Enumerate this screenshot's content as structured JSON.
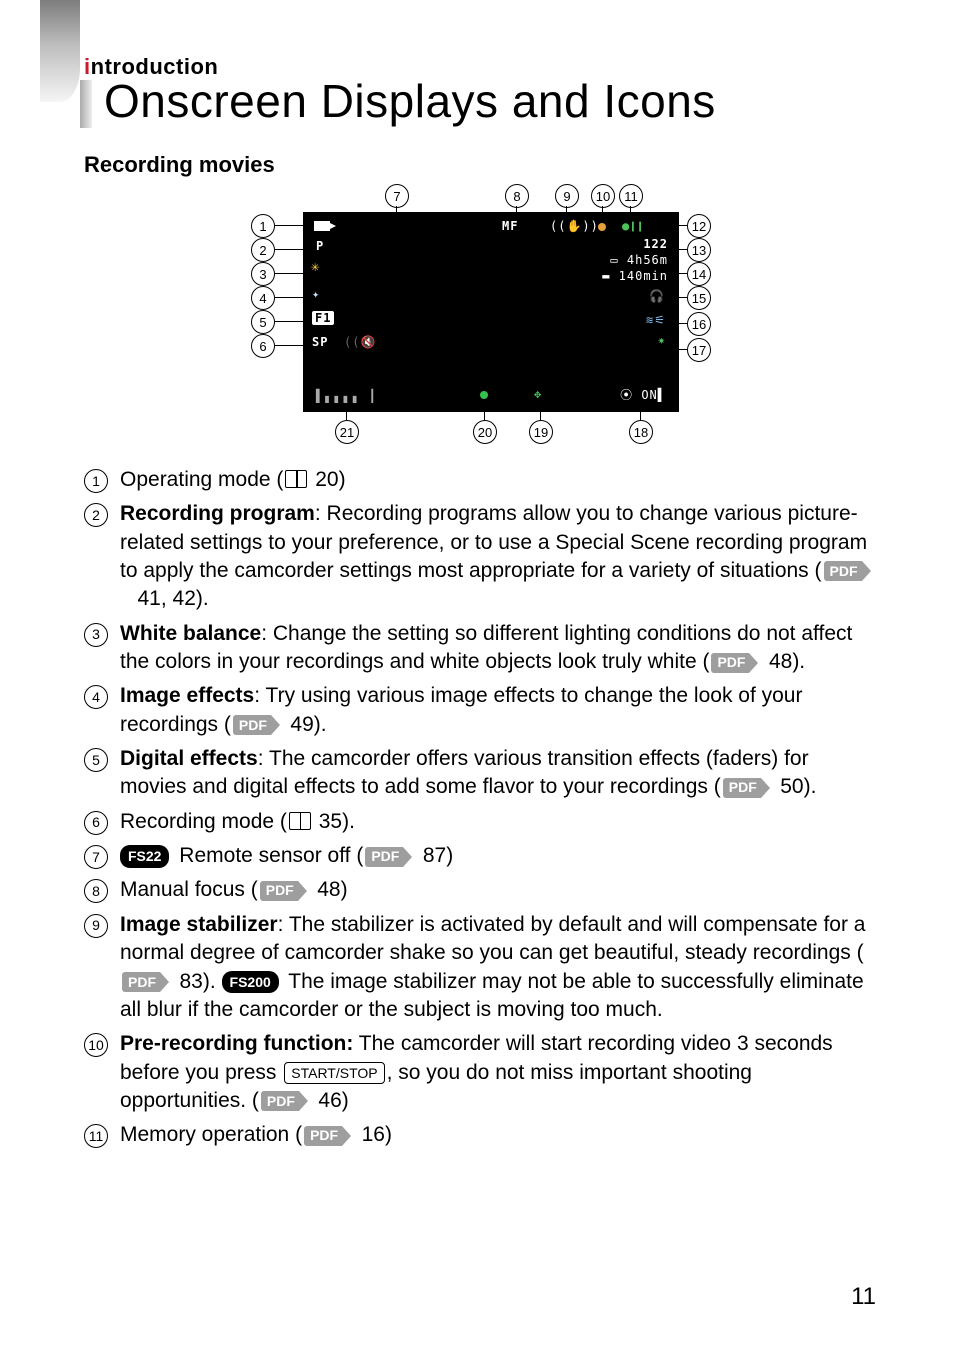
{
  "header": {
    "kicker_i": "i",
    "kicker_rest": "ntroduction",
    "title": "Onscreen Displays and Icons"
  },
  "section_heading": "Recording movies",
  "pdf_label": "PDF",
  "key_label": "START/STOP",
  "models": {
    "fs22": "FS22",
    "fs200": "FS200"
  },
  "diagram": {
    "top_numbers": [
      "7",
      "8",
      "9",
      "10",
      "11"
    ],
    "left_numbers": [
      "1",
      "2",
      "3",
      "4",
      "5",
      "6"
    ],
    "right_numbers": [
      "12",
      "13",
      "14",
      "15",
      "16",
      "17"
    ],
    "bottom_numbers": [
      "21",
      "20",
      "19",
      "18"
    ],
    "lcd": {
      "mf": "MF",
      "count": "122",
      "time": "4h56m",
      "battery": "140min",
      "sp": "SP",
      "p": "P",
      "f1": "F1",
      "on": "ON",
      "pause": "●❙❙"
    }
  },
  "notes": [
    {
      "n": "1",
      "lead": "",
      "title": "",
      "text_a": "Operating mode (",
      "book": true,
      "text_b": " 20)"
    },
    {
      "n": "2",
      "title": "Recording program",
      "text_a": ": Recording programs allow you to change various picture-related settings to your preference, or to use a Special Scene recording program to apply the camcorder settings most appropriate for a variety of situations (",
      "pdf": true,
      "text_b": " 41, 42)."
    },
    {
      "n": "3",
      "title": "White balance",
      "text_a": ": Change the setting so different lighting conditions do not affect the colors in your recordings and white objects look truly white (",
      "pdf": true,
      "text_b": " 48)."
    },
    {
      "n": "4",
      "title": "Image effects",
      "text_a": ": Try using various image effects to change the look of your recordings (",
      "pdf": true,
      "text_b": " 49)."
    },
    {
      "n": "5",
      "title": "Digital effects",
      "text_a": ": The camcorder offers various transition effects (faders) for movies and digital effects to add some flavor to your recordings (",
      "pdf": true,
      "text_b": " 50)."
    },
    {
      "n": "6",
      "title": "",
      "text_a": "Recording mode (",
      "book": true,
      "text_b": " 35)."
    },
    {
      "n": "7",
      "model": "fs22",
      "title": "",
      "text_a": " Remote sensor off (",
      "pdf": true,
      "text_b": " 87)"
    },
    {
      "n": "8",
      "title": "",
      "text_a": "Manual focus (",
      "pdf": true,
      "text_b": " 48)"
    },
    {
      "n": "9",
      "title": "Image stabilizer",
      "text_a": ": The stabilizer is activated by default and will compensate for a normal degree of camcorder shake so you can get beautiful, steady recordings (",
      "pdf": true,
      "text_b": " 83). ",
      "model2": "fs200",
      "text_c": " The image stabilizer may not be able to successfully eliminate all blur if the camcorder or the subject is moving too much."
    },
    {
      "n": "10",
      "title": "Pre-recording function:",
      "text_a": " The camcorder will start recording video 3 seconds before you press ",
      "key": true,
      "text_b": ", so you do not miss important shooting opportunities. (",
      "pdf": true,
      "text_c": " 46)"
    },
    {
      "n": "11",
      "title": "",
      "text_a": "Memory operation (",
      "pdf": true,
      "text_b": " 16)"
    }
  ],
  "folio": "11"
}
